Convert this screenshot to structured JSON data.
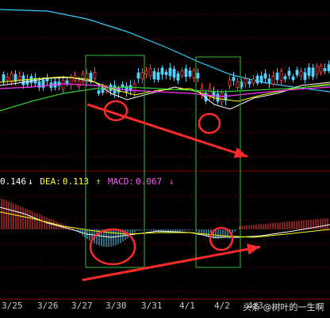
{
  "macd_legend": {
    "diff_text": "0.146",
    "diff_arrow": "↓",
    "dea_label": "DEA:",
    "dea_value": "0.113",
    "dea_arrow": "↑",
    "macd_label": "MACD:",
    "macd_value": "0.067",
    "macd_arrow": "↓"
  },
  "watermark": "头条 @树叶的一生啊",
  "colors": {
    "background": "#000000",
    "up_candle": "#ff4040",
    "down_candle": "#54d2ff",
    "ma_white": "#ffffff",
    "ma_yellow": "#ffff00",
    "ma_magenta": "#ff33ff",
    "ma_green": "#33cc33",
    "ma_cyan_long": "#33ccff",
    "annotation": "#ff2a2a",
    "highlight_box": "#2e9e2e"
  },
  "chart_data": {
    "type": "candlestick_with_macd",
    "x_ticks": [
      "3/25",
      "3/26",
      "3/27",
      "3/30",
      "3/31",
      "4/1",
      "4/2",
      "4/3"
    ],
    "price_panel": {
      "series": [
        {
          "name": "",
          "color": "#ffffff"
        },
        {
          "name": "",
          "color": "#ffff00"
        },
        {
          "name": "",
          "color": "#ff33ff"
        },
        {
          "name": "",
          "color": "#33cc33"
        },
        {
          "name": "",
          "color": "#33ccff"
        }
      ],
      "annotations": [
        "divergence arrow: falling lows",
        "circled low 3/30",
        "circled low 4/2"
      ]
    },
    "macd_panel": {
      "DIFF": 0.146,
      "DEA": 0.113,
      "MACD": 0.067,
      "annotations": [
        "divergence arrow: rising MACD troughs",
        "circled trough 3/30",
        "circled trough 4/2"
      ]
    }
  }
}
